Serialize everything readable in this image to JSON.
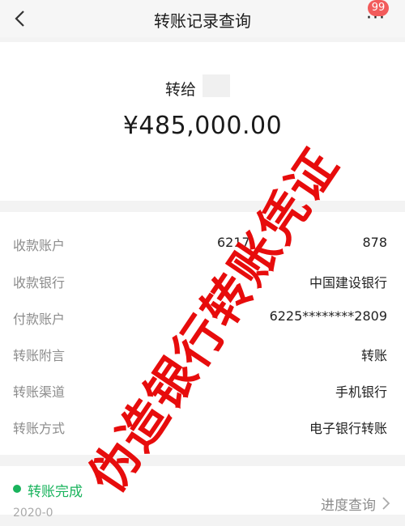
{
  "header": {
    "title": "转账记录查询",
    "badge_count": "99",
    "more_glyph": "···"
  },
  "transfer": {
    "to_label": "转给",
    "amount": "¥485,000.00"
  },
  "details": [
    {
      "key": "收款账户",
      "value_start": "6217",
      "value_end": "878"
    },
    {
      "key": "收款银行",
      "value": "中国建设银行"
    },
    {
      "key": "付款账户",
      "value": "6225********2809"
    },
    {
      "key": "转账附言",
      "value": "转账"
    },
    {
      "key": "转账渠道",
      "value": "手机银行"
    },
    {
      "key": "转账方式",
      "value": "电子银行转账"
    }
  ],
  "status": {
    "label": "转账完成",
    "link": "进度查询",
    "date": "2020-0"
  },
  "watermark": "伪造银行转账凭证",
  "colors": {
    "success": "#19b35c",
    "badge": "#f25b5b",
    "watermark": "#e60000"
  }
}
